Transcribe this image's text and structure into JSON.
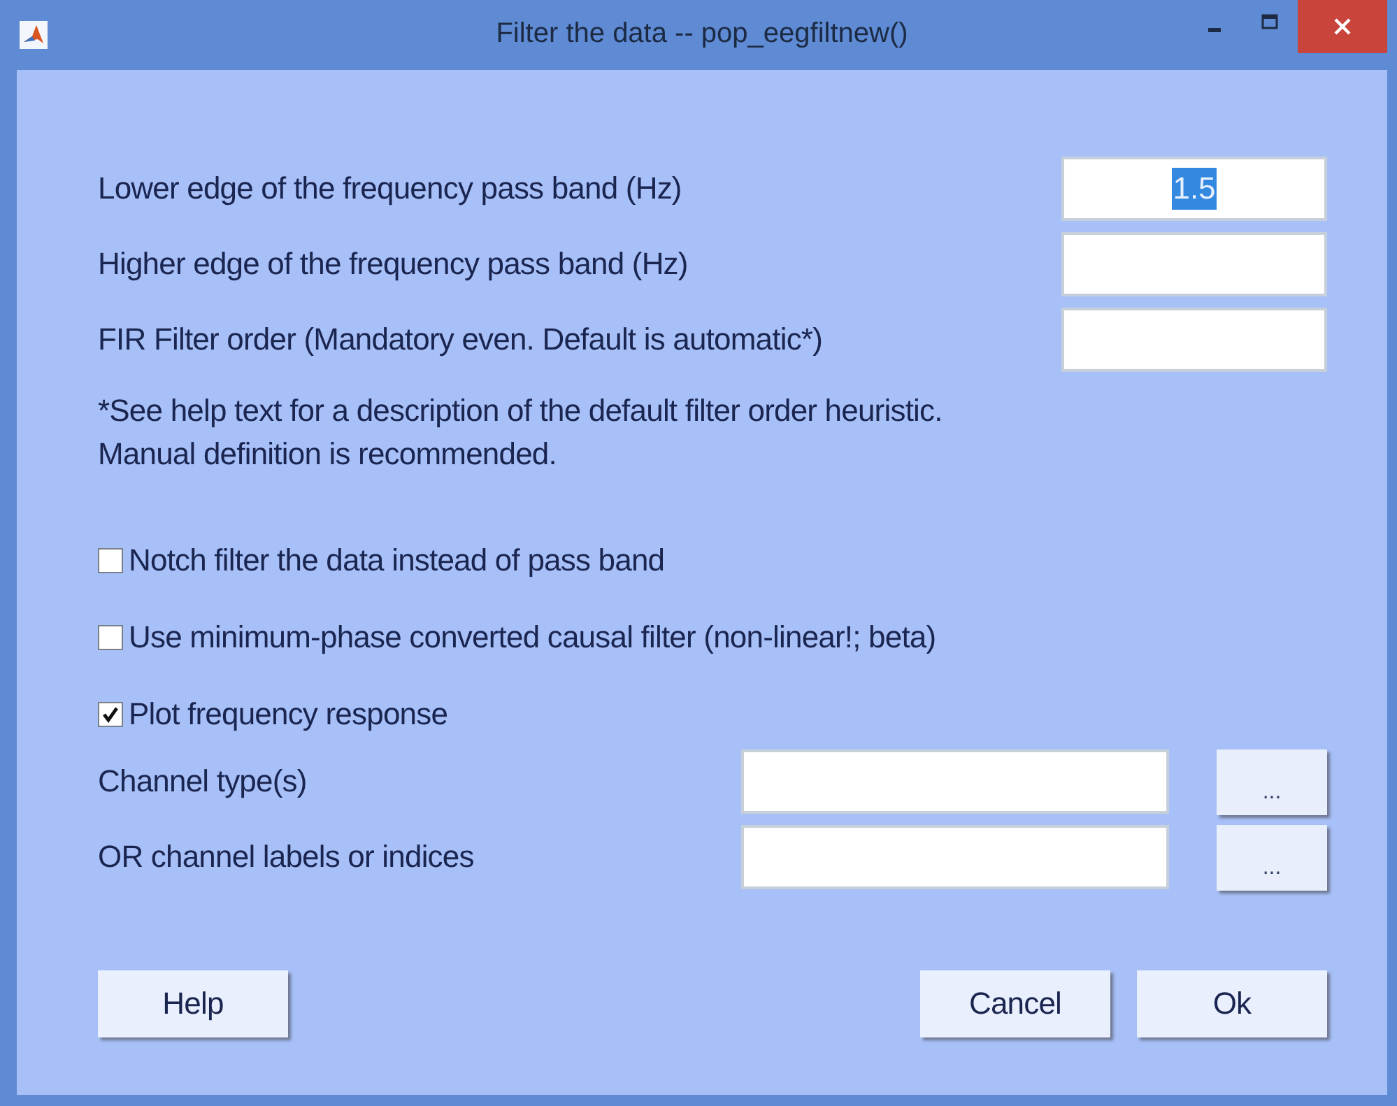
{
  "window": {
    "title": "Filter the data -- pop_eegfiltnew()"
  },
  "fields": [
    {
      "label": "Lower edge of the frequency pass band (Hz)",
      "value": "1.5",
      "text_selected": true
    },
    {
      "label": "Higher edge of the frequency pass band (Hz)"
    },
    {
      "label": "FIR Filter order (Mandatory even. Default is automatic*)"
    }
  ],
  "note": [
    "*See help text for a description of the default filter order heuristic.",
    "Manual definition is recommended."
  ],
  "options": [
    {
      "label": "Notch filter the data instead of pass band",
      "checked": false
    },
    {
      "label": "Use minimum-phase converted causal filter (non-linear!; beta)",
      "checked": false
    },
    {
      "label": "Plot frequency response",
      "checked": true
    }
  ],
  "channel_fields": [
    {
      "label": "Channel type(s)",
      "button": "..."
    },
    {
      "label": "OR channel labels or indices",
      "button": "..."
    }
  ],
  "buttons_left": [
    "Help"
  ],
  "buttons_right": [
    "Cancel",
    "Ok"
  ]
}
